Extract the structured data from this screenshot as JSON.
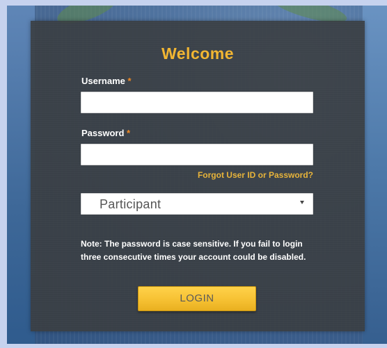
{
  "login_form": {
    "title": "Welcome",
    "username": {
      "label": "Username",
      "required_mark": "*",
      "value": "",
      "placeholder": ""
    },
    "password": {
      "label": "Password",
      "required_mark": "*",
      "value": "",
      "placeholder": ""
    },
    "forgot_link": "Forgot User ID or Password?",
    "role_select": {
      "selected": "Participant"
    },
    "note": "Note: The password is case sensitive. If you fail to login three consecutive times your account could be disabled.",
    "login_button": "LOGIN"
  },
  "colors": {
    "accent": "#f2b632",
    "panel": "#3a3e42",
    "button": "#f6c133",
    "required": "#f08a24"
  },
  "icons": {
    "select_arrow": "caret-down-icon"
  }
}
